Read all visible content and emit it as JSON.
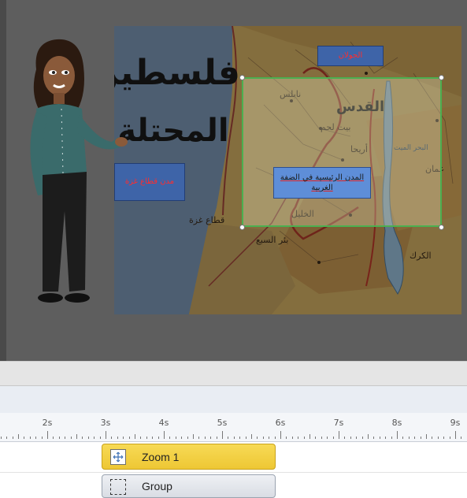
{
  "canvas": {
    "map": {
      "title_line_1": "فلسطين",
      "title_line_2": "المحتلة",
      "cities": {
        "jerusalem": "القدس",
        "bethlehem": "بيت لحم",
        "nablus": "نابلس",
        "hebron": "الخليل",
        "gaza_strip": "قطاع غزة",
        "beersheba": "بئر السبع",
        "jericho": "أريحا",
        "dead_sea": "البحر الميت",
        "amman": "عمان",
        "karak": "الكرك",
        "golan": "الجولان"
      },
      "callout_gaza": "مدن قطاع غزة",
      "callout_top": "الجولان"
    },
    "zoom_region_label": "المدن الرئيسية في الضفة الغربية"
  },
  "timeline": {
    "ruler_labels": [
      "2s",
      "3s",
      "4s",
      "5s",
      "6s",
      "7s",
      "8s",
      "9s"
    ],
    "clips": [
      {
        "label": "Zoom 1",
        "icon": "zoom-icon",
        "color": "#f2cf3f"
      },
      {
        "label": "Group",
        "icon": "group-icon"
      }
    ]
  },
  "colors": {
    "zoom_border": "#4caf50",
    "label_box": "#3e64a8",
    "zoom_clip": "#f2cf3f"
  }
}
